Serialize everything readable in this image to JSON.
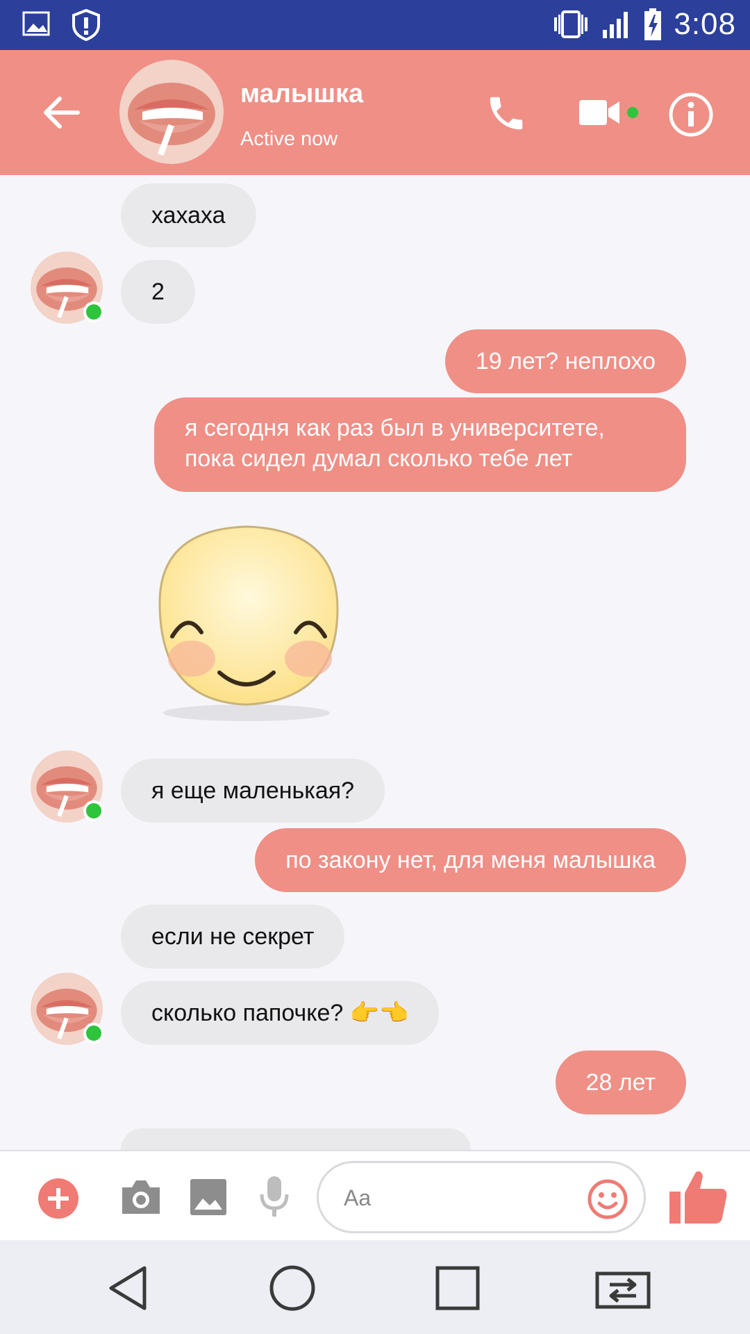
{
  "status_bar": {
    "time": "3:08",
    "icons": [
      "gallery-icon",
      "shield-alert-icon",
      "vibrate-icon",
      "signal-icon",
      "battery-charging-icon"
    ]
  },
  "header": {
    "contact_name": "малышка",
    "contact_status": "Active now",
    "icons": [
      "back-arrow-icon",
      "phone-icon",
      "video-camera-icon",
      "info-icon"
    ]
  },
  "messages": [
    {
      "side": "in",
      "text": "хахаха"
    },
    {
      "side": "in",
      "text": "2"
    },
    {
      "side": "out",
      "text": "19 лет? неплохо"
    },
    {
      "side": "out",
      "lines": [
        "я сегодня как раз был в университете,",
        "пока сидел думал сколько тебе лет"
      ]
    },
    {
      "side": "in",
      "sticker": "smiling-face-sticker"
    },
    {
      "side": "in",
      "text": "я еще маленькая?"
    },
    {
      "side": "out",
      "text": "по закону нет, для меня малышка"
    },
    {
      "side": "in",
      "text": "если не секрет"
    },
    {
      "side": "in",
      "text": "сколько папочке? 👉👈"
    },
    {
      "side": "out",
      "text": "28 лет"
    }
  ],
  "composer": {
    "placeholder": "Aa",
    "icons": [
      "plus-icon",
      "camera-icon",
      "image-icon",
      "microphone-icon",
      "emoji-icon",
      "thumbs-up-icon"
    ]
  },
  "nav_bar": {
    "icons": [
      "nav-back-icon",
      "nav-home-icon",
      "nav-recents-icon",
      "nav-switch-icon"
    ]
  },
  "colors": {
    "status_bar": "#2c3f9b",
    "accent": "#ef8f86",
    "incoming_bubble": "#e9e9ec",
    "online": "#2ec43c"
  }
}
